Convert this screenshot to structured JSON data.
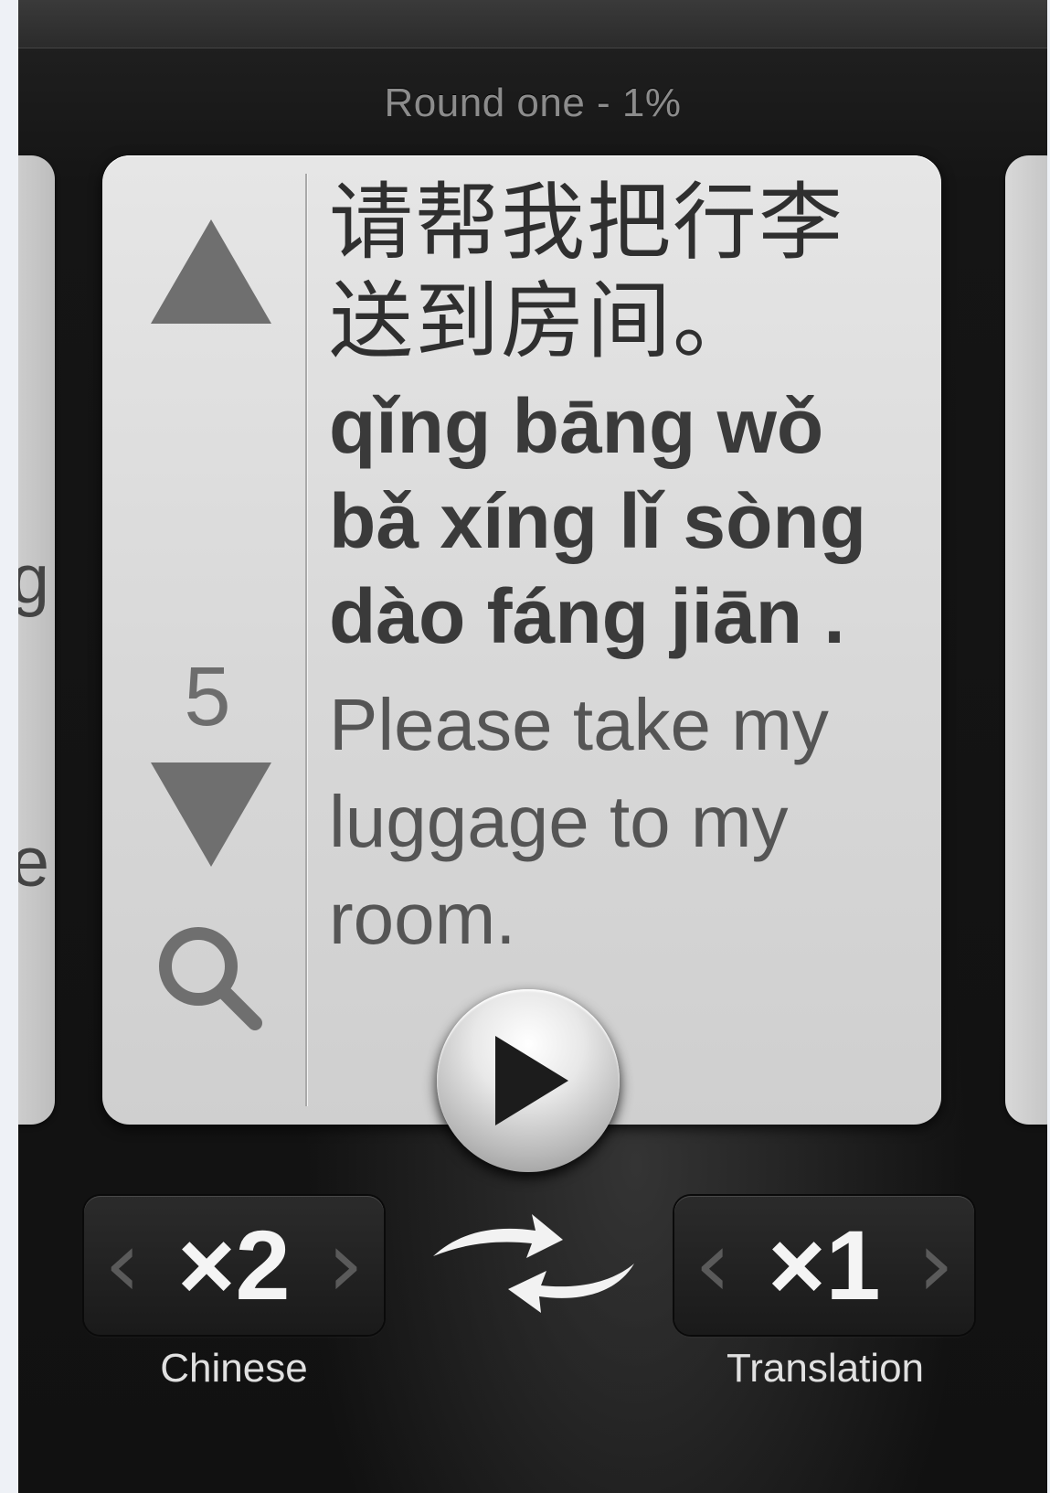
{
  "header": {
    "round_text": "Round one - 1%"
  },
  "side_cards": {
    "left_fragments": [
      "g",
      "e"
    ]
  },
  "card": {
    "phrase_number": "5",
    "hanzi_line1": "请帮我把行李",
    "hanzi_line2": "送到房间。",
    "pinyin_line1": "qǐng bāng wǒ",
    "pinyin_line2": "bǎ xíng lǐ sòng",
    "pinyin_line3": "dào fáng jiān .",
    "translation_line1": "Please take my",
    "translation_line2": "luggage to my",
    "translation_line3": "room."
  },
  "controls": {
    "chinese": {
      "value": "×2",
      "label": "Chinese"
    },
    "translation": {
      "value": "×1",
      "label": "Translation"
    }
  },
  "icons": {
    "up": "triangle-up-icon",
    "down": "triangle-down-icon",
    "search": "search-icon",
    "play": "play-icon",
    "swap": "swap-arrows-icon"
  }
}
